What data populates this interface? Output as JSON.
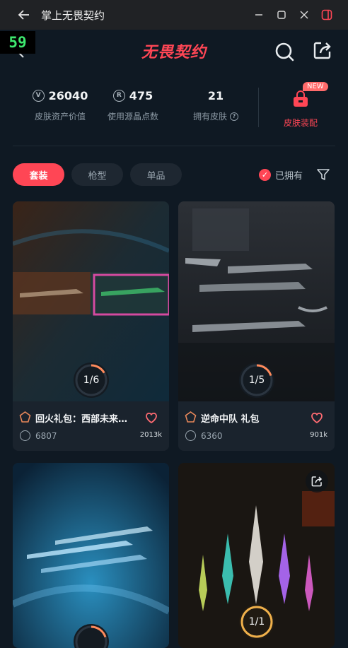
{
  "window": {
    "title": "掌上无畏契约"
  },
  "fps": "59",
  "app": {
    "logo": "无畏契约"
  },
  "stats": [
    {
      "value": "26040",
      "label": "皮肤资产价值",
      "icon": "vp-coin-icon"
    },
    {
      "value": "475",
      "label": "使用源晶点数",
      "icon": "radianite-icon"
    },
    {
      "value": "21",
      "label": "拥有皮肤",
      "icon": "help-icon"
    }
  ],
  "equip": {
    "label": "皮肤装配",
    "badge": "NEW"
  },
  "filters": {
    "tabs": [
      "套装",
      "枪型",
      "单品"
    ],
    "active": 0,
    "owned_label": "已拥有"
  },
  "cards": [
    {
      "name": "回火礼包：西部未来…",
      "price": "6807",
      "likes": "2013k",
      "progress": "1/6",
      "progress_value": 0.167
    },
    {
      "name": "逆命中队 礼包",
      "price": "6360",
      "likes": "901k",
      "progress": "1/5",
      "progress_value": 0.2
    },
    {
      "name": "",
      "price": "",
      "likes": "",
      "progress": "",
      "progress_value": 0.2
    },
    {
      "name": "",
      "price": "",
      "likes": "",
      "progress": "1/1",
      "progress_value": 1
    }
  ],
  "colors": {
    "accent": "#ff4655",
    "bg": "#0f1923",
    "card": "#1a232d"
  }
}
